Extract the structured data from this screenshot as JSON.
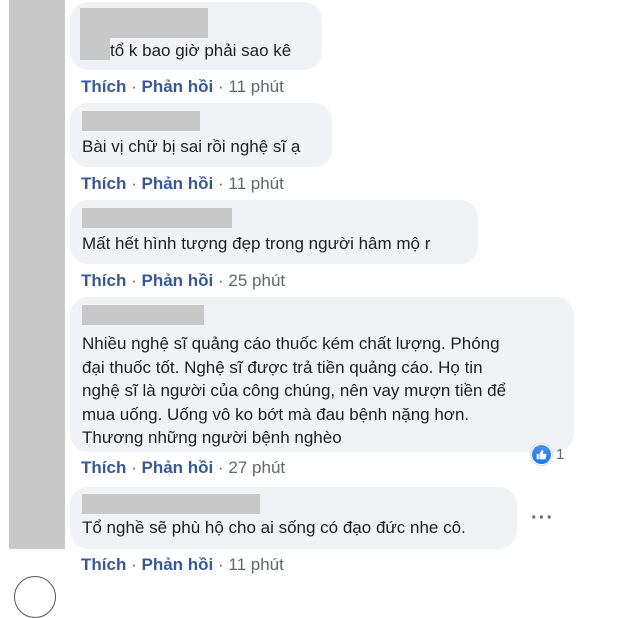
{
  "comments": [
    {
      "text": "tổ k bao giờ phải sao kê",
      "like_label": "Thích",
      "reply_label": "Phản hồi",
      "separator": "·",
      "time": "11 phút"
    },
    {
      "text": "Bài vị chữ bị sai rồi nghệ sĩ ạ",
      "like_label": "Thích",
      "reply_label": "Phản hồi",
      "separator": "·",
      "time": "11 phút"
    },
    {
      "text": "Mất hết hình tượng đẹp trong người hâm mộ r",
      "like_label": "Thích",
      "reply_label": "Phản hồi",
      "separator": "·",
      "time": "25 phút"
    },
    {
      "lines": [
        "Nhiều nghệ sĩ quảng cáo thuốc kém chất lượng. Phóng",
        "đại thuốc tốt. Nghệ sĩ được trả tiền quảng cáo. Họ tin",
        "nghệ sĩ là người của công chúng, nên vay mượn tiền để",
        "mua uống. Uống vô ko bớt mà đau bệnh nặng hơn.",
        "Thương những người bệnh nghèo"
      ],
      "like_label": "Thích",
      "reply_label": "Phản hồi",
      "separator": "·",
      "time": "27 phút",
      "reaction_count": "1"
    },
    {
      "text": "Tổ nghề sẽ phù hộ cho ai sống có đạo đức nhe cô.",
      "like_label": "Thích",
      "reply_label": "Phản hồi",
      "separator": "·",
      "time": "11 phút",
      "more": "···"
    }
  ]
}
